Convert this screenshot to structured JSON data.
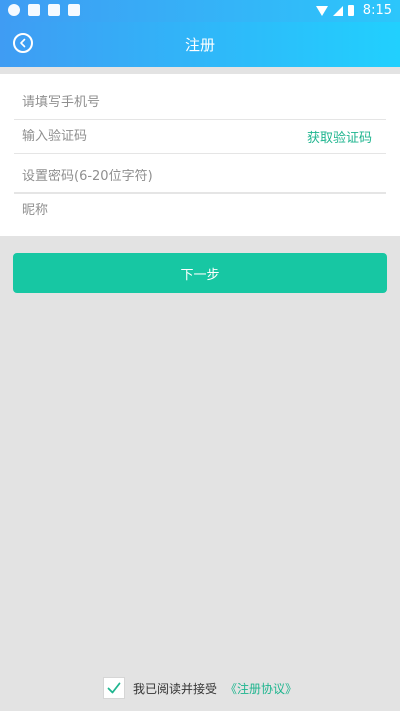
{
  "status_bar": {
    "time": "8:15",
    "icons": [
      "app-icon",
      "keyboard-icon",
      "storage-icon",
      "font-icon",
      "wifi-icon",
      "signal-icon",
      "battery-icon"
    ]
  },
  "header": {
    "title": "注册",
    "back_icon": "back-circle-icon",
    "gradient_start": "#3f9cf3",
    "gradient_end": "#21d0fe"
  },
  "form": {
    "phone_placeholder": "请填写手机号",
    "code_placeholder": "输入验证码",
    "get_code_label": "获取验证码",
    "password_placeholder": "设置密码(6-20位字符)",
    "nickname_placeholder": "昵称"
  },
  "next_button": {
    "label": "下一步",
    "color": "#17c7a3"
  },
  "agreement": {
    "checked": true,
    "text": "我已阅读并接受",
    "link": "《注册协议》",
    "accent": "#1fb58f"
  }
}
